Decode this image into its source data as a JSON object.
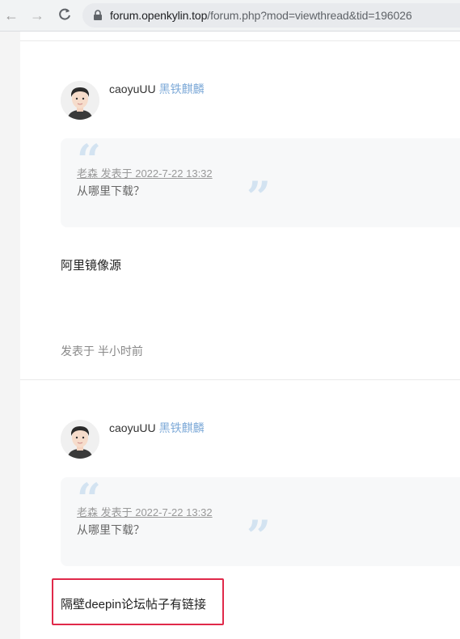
{
  "browser": {
    "url_domain": "forum.openkylin.top",
    "url_path": "/forum.php?mod=viewthread&tid=196026"
  },
  "posts": [
    {
      "username": "caoyuUU",
      "group": "黑铁麒麟",
      "quote": {
        "meta": "老森 发表于 2022-7-22 13:32",
        "text": "从哪里下载？"
      },
      "reply": "阿里镜像源",
      "time": "发表于 半小时前"
    },
    {
      "username": "caoyuUU",
      "group": "黑铁麒麟",
      "quote": {
        "meta": "老森 发表于 2022-7-22 13:32",
        "text": "从哪里下载？"
      },
      "reply": "隔壁deepin论坛帖子有链接"
    }
  ],
  "colors": {
    "accent_group": "#7eaad8",
    "highlight_border": "#e0294a",
    "quote_mark": "#d3e3f1"
  }
}
